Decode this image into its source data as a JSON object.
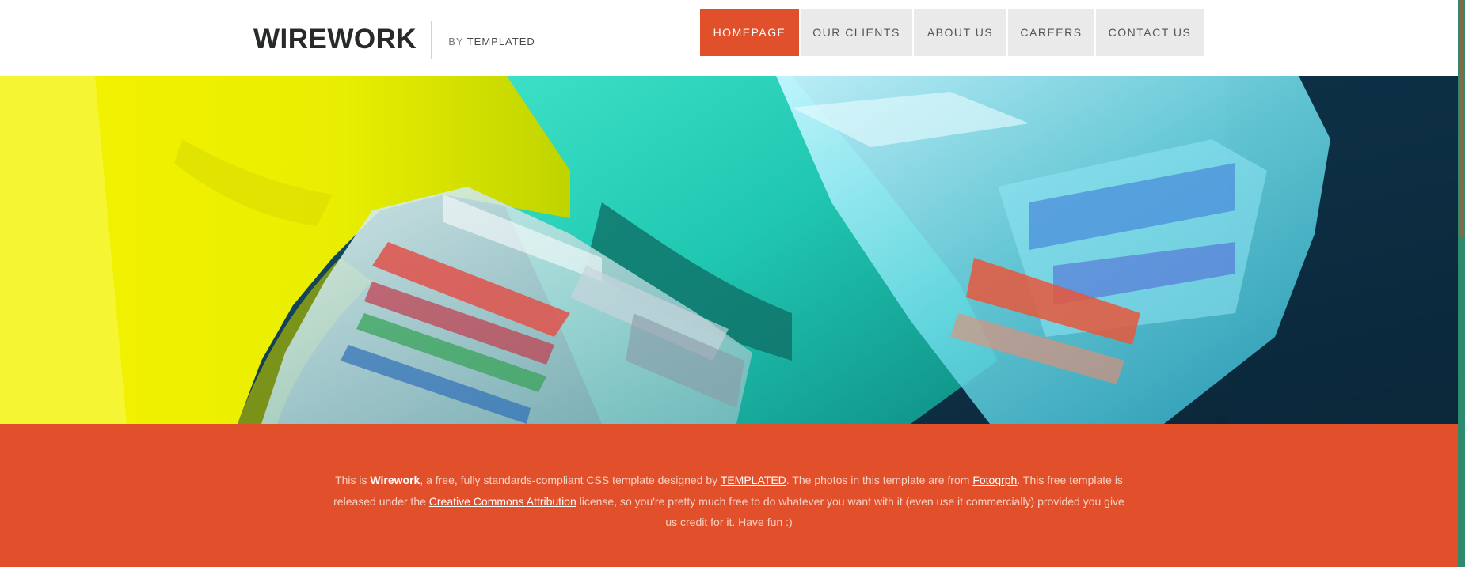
{
  "header": {
    "logo_title": "WIREWORK",
    "by_prefix": "BY",
    "by_brand": "TEMPLATED"
  },
  "nav": {
    "items": [
      {
        "label": "HOMEPAGE",
        "active": true
      },
      {
        "label": "OUR CLIENTS",
        "active": false
      },
      {
        "label": "ABOUT US",
        "active": false
      },
      {
        "label": "CAREERS",
        "active": false
      },
      {
        "label": "CONTACT US",
        "active": false
      }
    ]
  },
  "hero": {
    "image_subject": "ethernet-cable-connectors"
  },
  "footer": {
    "t1": "This is ",
    "brand": "Wirework",
    "t2": ", a free, fully standards-compliant CSS template designed by ",
    "link_templated": "TEMPLATED",
    "t3": ". The photos in this template are from ",
    "link_fotogrph": "Fotogrph",
    "t4": ". This free template is released under the ",
    "link_license": "Creative Commons Attribution",
    "t5": " license, so you're pretty much free to do whatever you want with it (even use it commercially) provided you give us credit for it. Have fun :)"
  },
  "colors": {
    "accent": "#e0502a",
    "nav_bg": "#eaeaea",
    "logo_text": "#27292b",
    "footer_bg": "#e1502a"
  }
}
